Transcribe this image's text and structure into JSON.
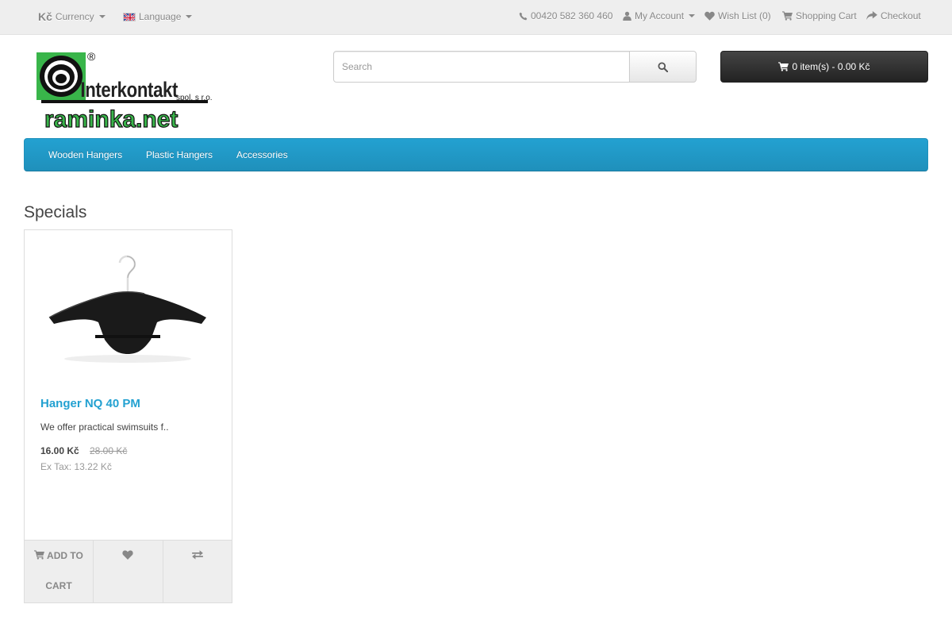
{
  "topbar": {
    "currency_symbol": "Kč",
    "currency_label": "Currency",
    "language_label": "Language",
    "phone": "00420 582 360 460",
    "my_account": "My Account",
    "wishlist": "Wish List (0)",
    "shopping_cart": "Shopping Cart",
    "checkout": "Checkout"
  },
  "logo": {
    "line1": "Interkontakt",
    "line2": "spol. s r.o.",
    "line3": "raminka.net",
    "reg": "®"
  },
  "search": {
    "placeholder": "Search"
  },
  "cart": {
    "label": "0 item(s) - 0.00 Kč"
  },
  "menu": {
    "items": [
      {
        "label": "Wooden Hangers"
      },
      {
        "label": "Plastic Hangers"
      },
      {
        "label": "Accessories"
      }
    ]
  },
  "section": {
    "title": "Specials"
  },
  "products": [
    {
      "name": "Hanger NQ 40 PM",
      "description": "We offer practical swimsuits f..",
      "price_new": "16.00 Kč",
      "price_old": "28.00 Kč",
      "ex_tax": "Ex Tax: 13.22 Kč",
      "add_to_cart": "Add to Cart"
    }
  ],
  "colors": {
    "accent": "#23a1d1",
    "logo_green": "#39b54a",
    "cart_button": "#333333"
  },
  "icons": [
    "phone-icon",
    "user-icon",
    "heart-icon",
    "shopping-cart-icon",
    "share-icon",
    "search-icon",
    "exchange-icon"
  ]
}
